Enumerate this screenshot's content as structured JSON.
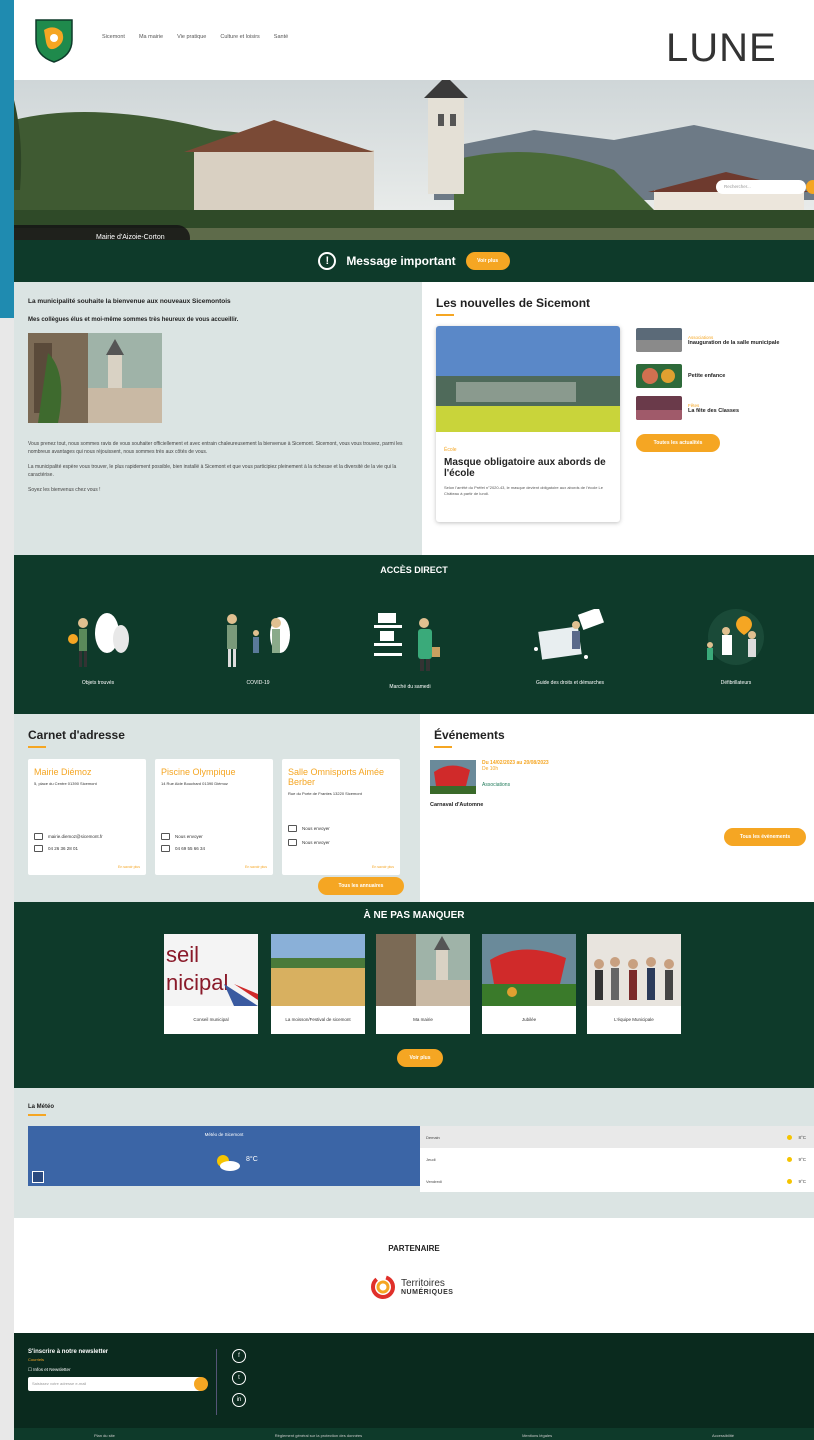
{
  "header": {
    "nav": [
      "Sicemont",
      "Ma mairie",
      "Vie pratique",
      "Culture et loisirs",
      "Santé"
    ],
    "lune": "LUNE",
    "search_placeholder": "Rechercher..."
  },
  "hero": {
    "label": "Mairie d'Aizoie-Corton"
  },
  "important": {
    "title": "Message important",
    "button": "Voir plus"
  },
  "welcome": {
    "title": "La municipalité souhaite la bienvenue aux nouveaux Sicemontois",
    "subtitle": "Mes collègues élus et moi-même sommes très heureux de vous accueillir.",
    "p1": "Vous prenez tout, nous sommes ravis de vous souhaiter officiellement et avec entrain chaleureusement la bienvenue à Sicemont. Sicemont, vous vous trouvez, parmi les nombreux avantages qui nous réjouissent, nous sommes très aux côtés de vous.",
    "p2": "La municipalité espère vous trouver, le plus rapidement possible, bien installé à Sicemont et que vous participiez pleinement à la richesse et la diversité de la vie qui la caractérise.",
    "p3": "Soyez les bienvenus chez vous !"
  },
  "news": {
    "title": "Les nouvelles de Sicemont",
    "card": {
      "category": "École",
      "title": "Masque obligatoire aux abords de l'école",
      "desc": "Selon l'arrêté du Préfet n°2020-43, le masque devient obligatoire aux abords de l'école Le Château à partir de lundi."
    },
    "items": [
      {
        "category": "Associations",
        "title": "Inauguration de la salle municipale"
      },
      {
        "category": "",
        "title": "Petite enfance"
      },
      {
        "category": "Fêtes",
        "title": "La fête des Classes"
      }
    ],
    "button": "Toutes les actualités"
  },
  "acces": {
    "title": "ACCÈS DIRECT",
    "items": [
      "Objets trouvés",
      "COVID-19",
      "Marché du samedi",
      "Guide des droits et démarches",
      "Défibrillateurs"
    ]
  },
  "carnet": {
    "title": "Carnet d'adresse",
    "cards": [
      {
        "name": "Mairie Diémoz",
        "addr": "5, place du Centre 01390 Sicemont",
        "email": "mairie.diemoz@sicemont.fr",
        "phone": "04 26 36 28 01"
      },
      {
        "name": "Piscine Olympique",
        "addr": "14 Rue Aide Bouchard 01390 Diémoz",
        "email": "Nous envoyer",
        "phone": "04 69 55 66 34"
      },
      {
        "name": "Salle Omnisports Aimée Berber",
        "addr": "Rue du Porte de Frantes 13220 Sicemont",
        "email": "Nous envoyer",
        "phone": "Nous envoyer"
      }
    ],
    "more": "En savoir plus",
    "button": "Tous les annuaires"
  },
  "events": {
    "title": "Événements",
    "item": {
      "date": "Du 14/02/2023 au 20/08/2023",
      "subdate": "De 10h",
      "tag": "Associations",
      "name": "Carnaval d'Automne"
    },
    "button": "Tous les évènements"
  },
  "manquer": {
    "title": "À NE PAS MANQUER",
    "items": [
      "Conseil municipal",
      "La moisson/Festival de sicemont",
      "Ma mairie",
      "Jubilée",
      "L'équipe Municipale"
    ],
    "button": "Voir plus"
  },
  "meteo": {
    "title": "La Météo",
    "city": "Météo de Sicemont",
    "temp": "8°C",
    "rows": [
      {
        "day": "Demain",
        "val": "8°C"
      },
      {
        "day": "Jeudi",
        "val": "9°C"
      },
      {
        "day": "Vendredi",
        "val": "9°C"
      }
    ]
  },
  "partenaire": {
    "title": "PARTENAIRE",
    "logo_line1": "Territoires",
    "logo_line2": "NUMÉRIQUES"
  },
  "footer": {
    "newsletter_title": "S'inscrire à notre newsletter",
    "newsletter_sub": "Courriels",
    "checkbox_label": "Infos et Newsletter",
    "input_placeholder": "Saisissez votre adresse e-mail",
    "social": [
      "f",
      "t",
      "in"
    ],
    "links": [
      "Plan du site",
      "Règlement général sur la protection des données",
      "Mentions légales",
      "Accessibilité"
    ]
  },
  "colors": {
    "green_dark": "#0e3a2a",
    "orange": "#f5a623",
    "gray_bg": "#dbe4e3",
    "frame_blue": "#1f8bb0"
  }
}
